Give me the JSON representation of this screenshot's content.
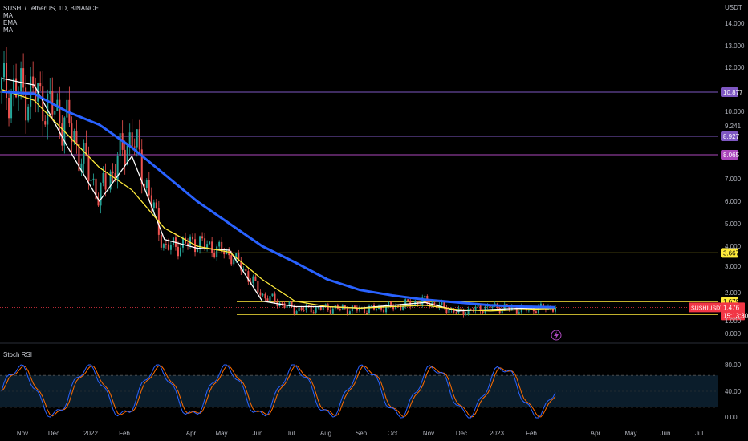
{
  "header": {
    "symbol_line": "SUSHI / TetherUS, 1D, BINANCE",
    "indicators": [
      "MA",
      "EMA",
      "MA"
    ]
  },
  "price_axis": {
    "unit_label": "USDT",
    "ticks": [
      "14.000",
      "13.000",
      "12.000",
      "10.000",
      "9.241",
      "7.000",
      "6.000",
      "5.000",
      "4.000",
      "3.000",
      "2.000",
      "1.000",
      "0.000"
    ],
    "tick_values": [
      14,
      13,
      12,
      10,
      9.241,
      7,
      6,
      5,
      4,
      3,
      2,
      1,
      0
    ],
    "tick_prices": [
      14.0,
      13.0,
      12.0,
      10.0,
      9.241,
      7.0,
      6.0,
      5.0,
      4.0,
      3.0,
      2.0,
      1.0,
      0.0
    ],
    "label_boxes": [
      {
        "text": "10.877",
        "price": 10.877,
        "color": "#7e57c2"
      },
      {
        "text": "8.927",
        "price": 8.927,
        "color": "#7e57c2"
      },
      {
        "text": "8.065",
        "price": 8.065,
        "color": "#ab47bc"
      },
      {
        "text": "3.667",
        "price": 3.667,
        "color": "#ffeb3b"
      },
      {
        "text": "1.679",
        "price": 1.679,
        "color": "#ffeb3b"
      },
      {
        "text": "1.220",
        "price": 1.22,
        "color": "#ffeb3b"
      }
    ],
    "current": {
      "symbol": "SUSHIUSDT",
      "price": "1.476",
      "countdown": "15:13:30",
      "color": "#f23645"
    }
  },
  "stoch_rsi": {
    "label": "Stoch RSI",
    "ticks": [
      "80.00",
      "40.00",
      "0.00"
    ],
    "tick_values": [
      80,
      40,
      0
    ],
    "band": [
      20,
      80
    ]
  },
  "time_axis": {
    "labels": [
      "Nov",
      "Dec",
      "2022",
      "Feb",
      "Apr",
      "May",
      "Jun",
      "Jul",
      "Aug",
      "Sep",
      "Oct",
      "Nov",
      "Dec",
      "2023",
      "Feb",
      "Apr",
      "May",
      "Jun",
      "Jul"
    ]
  },
  "chart_data": {
    "type": "line",
    "title": "SUSHI / TetherUS, 1D, BINANCE",
    "ylabel": "USDT",
    "ylim": [
      0,
      14.5
    ],
    "x": [
      "Nov",
      "Dec",
      "2022",
      "Feb",
      "Apr",
      "May",
      "Jun",
      "Jul",
      "Aug",
      "Sep",
      "Oct",
      "Nov",
      "Dec",
      "2023",
      "Feb"
    ],
    "series": [
      {
        "name": "price",
        "color": "#26a69a",
        "values": [
          11.0,
          10.8,
          9.5,
          6.2,
          9.0,
          3.9,
          4.2,
          3.6,
          1.9,
          1.4,
          1.45,
          1.4,
          1.5,
          1.7,
          1.3,
          1.5,
          1.4,
          1.476
        ]
      },
      {
        "name": "MA",
        "color": "#ffffff",
        "values": [
          11.5,
          11.2,
          8.5,
          6.0,
          8.0,
          4.3,
          3.9,
          3.8,
          1.7,
          1.5,
          1.5,
          1.45,
          1.55,
          1.65,
          1.35,
          1.4,
          1.45,
          1.46
        ]
      },
      {
        "name": "EMA",
        "color": "#ffeb3b",
        "values": [
          11.0,
          10.5,
          9.0,
          7.5,
          6.5,
          4.8,
          4.0,
          3.7,
          2.5,
          1.7,
          1.5,
          1.45,
          1.5,
          1.55,
          1.4,
          1.35,
          1.4,
          1.44
        ]
      },
      {
        "name": "MA",
        "color": "#2962ff",
        "values": [
          10.9,
          10.8,
          10.0,
          9.3,
          8.4,
          7.2,
          6.0,
          5.0,
          4.0,
          3.2,
          2.5,
          2.1,
          1.9,
          1.75,
          1.65,
          1.55,
          1.5,
          1.48
        ]
      }
    ],
    "hlines": [
      10.877,
      8.927,
      8.065,
      3.667,
      1.679,
      1.22
    ]
  }
}
